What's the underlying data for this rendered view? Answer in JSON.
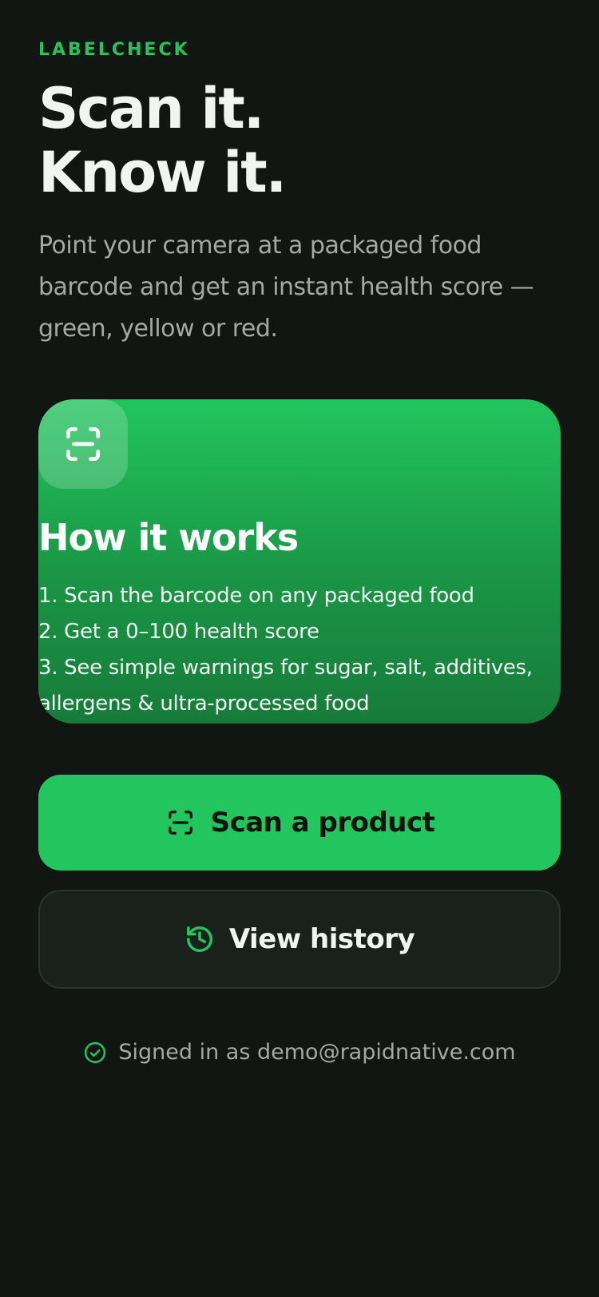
{
  "brand": "LABELCHECK",
  "headline": {
    "line1": "Scan it.",
    "line2": "Know it."
  },
  "subtitle": "Point your camera at a packaged food barcode and get an instant health score — green, yellow or red.",
  "how_it_works": {
    "icon": "scan-icon",
    "title": "How it works",
    "steps": [
      "1. Scan the barcode on any packaged food",
      "2. Get a 0–100 health score",
      "3. See simple warnings for sugar, salt, additives, allergens & ultra-processed food"
    ]
  },
  "actions": {
    "scan_label": "Scan a product",
    "scan_icon": "scan-icon",
    "history_label": "View history",
    "history_icon": "history-icon"
  },
  "account": {
    "icon": "check-circle-icon",
    "signed_in_text": "Signed in as demo@rapidnative.com"
  },
  "colors": {
    "background": "#121612",
    "accent": "#22c55e",
    "card_gradient_end": "#177b3a",
    "secondary_button": "#1a211b",
    "muted_text": "#a4aaa3"
  }
}
